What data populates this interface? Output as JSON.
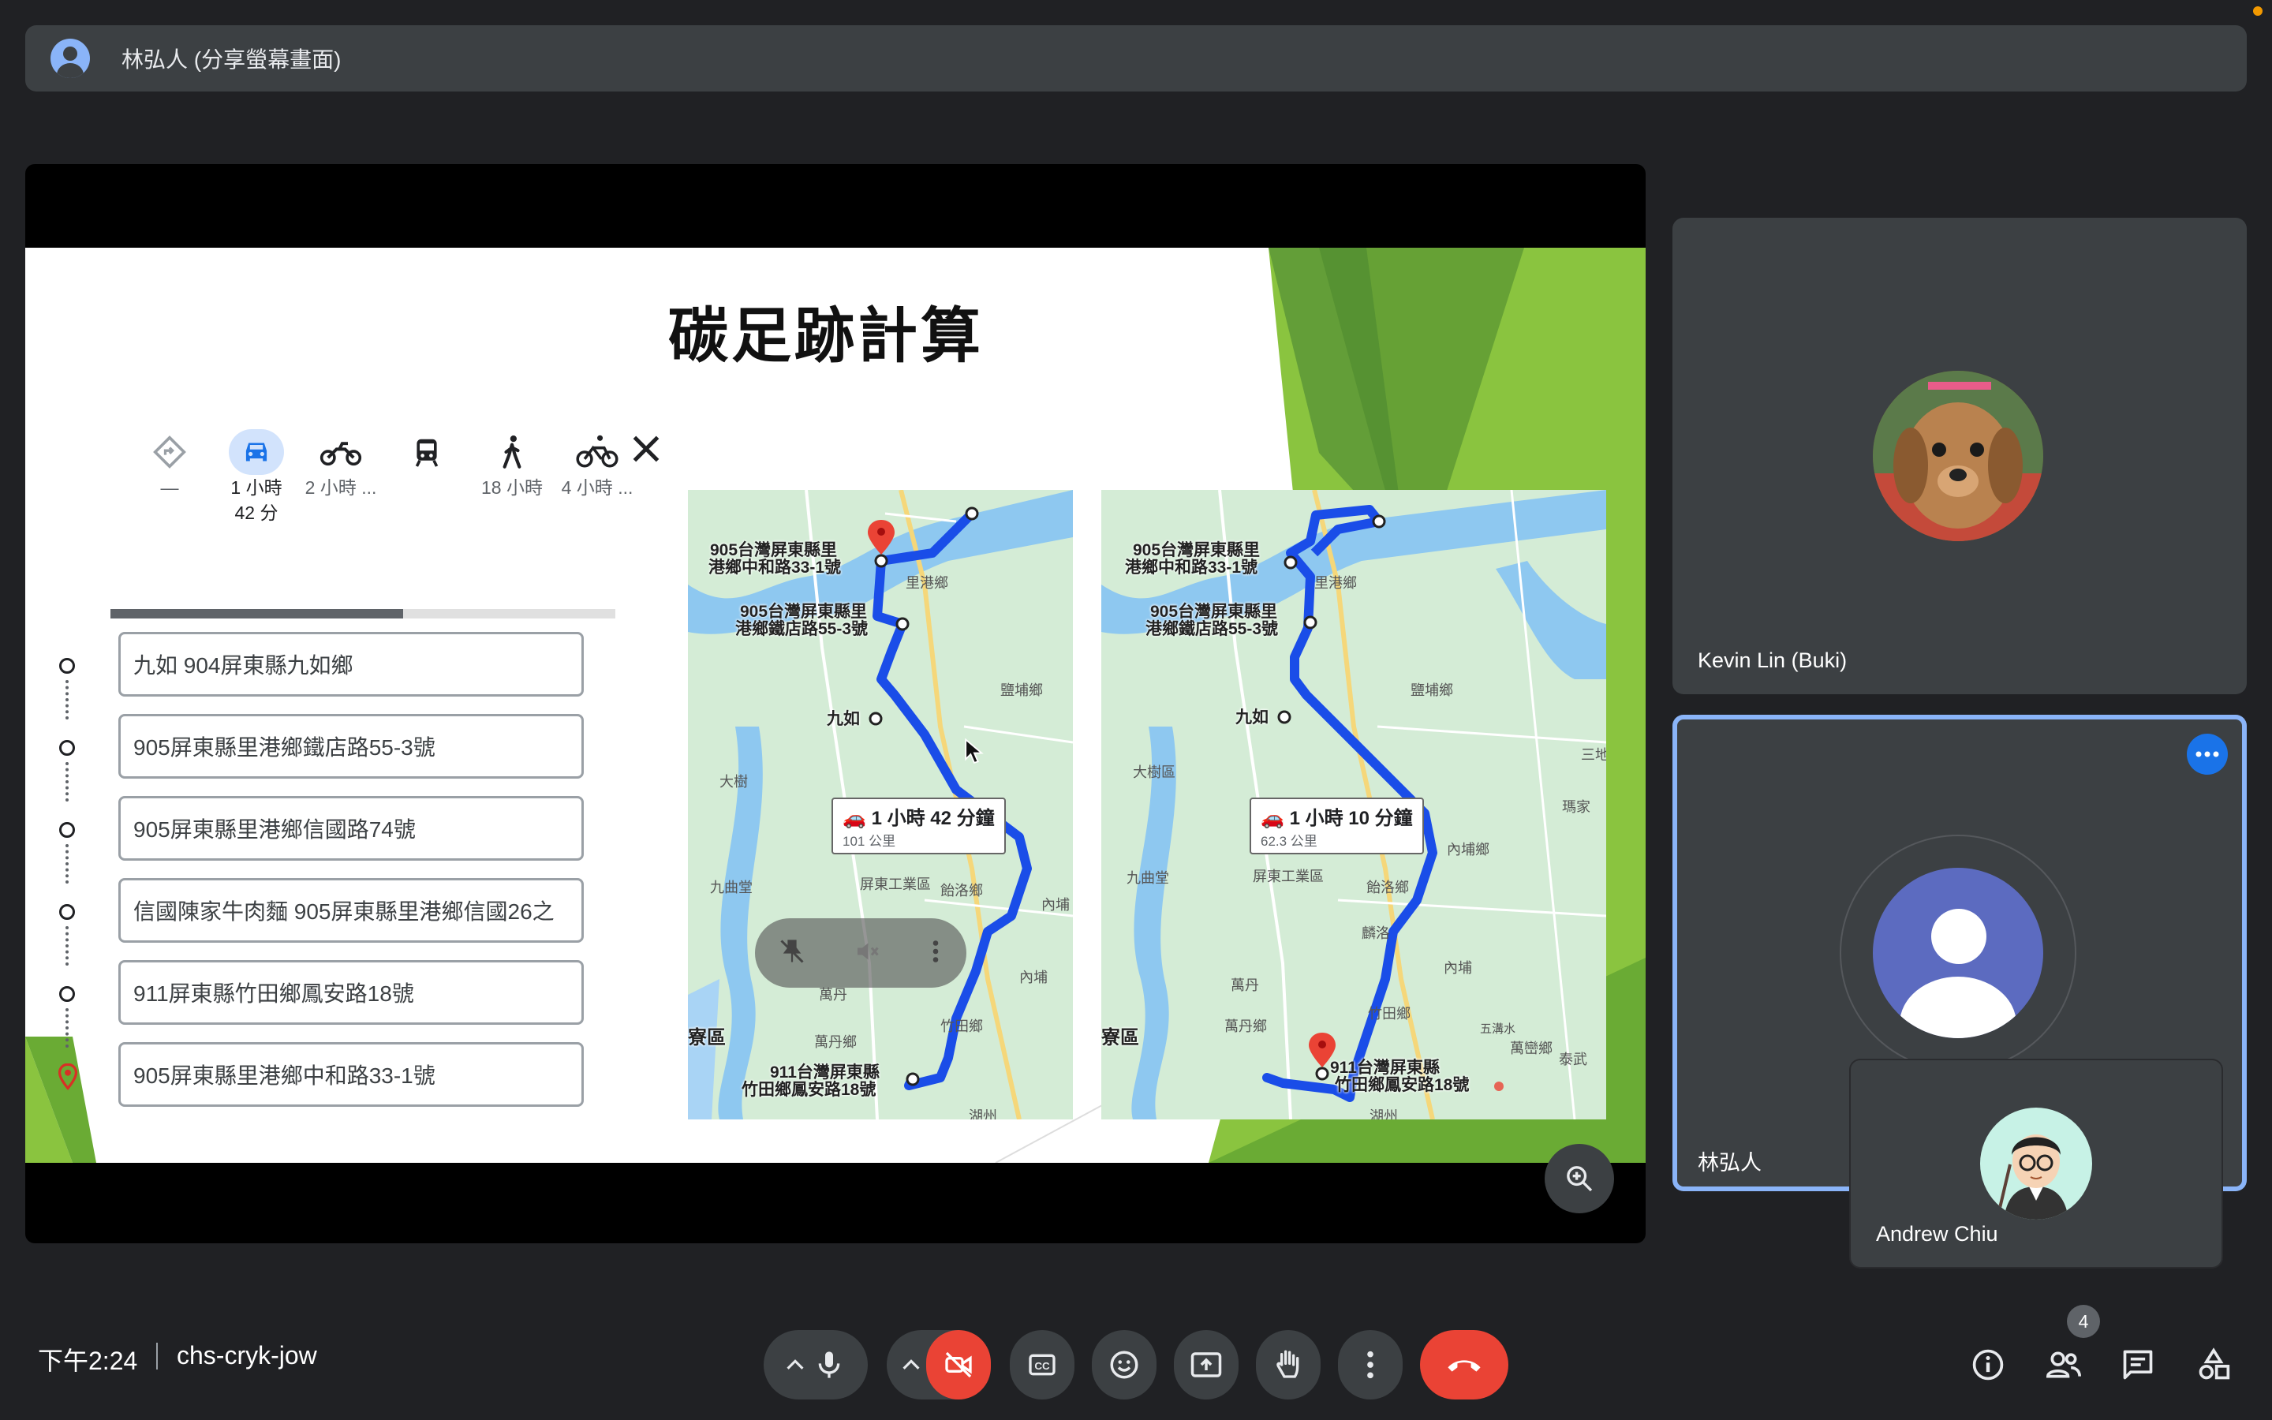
{
  "presenter_bar": {
    "title": "林弘人 (分享螢幕畫面)"
  },
  "slide": {
    "title": "碳足跡計算",
    "modes": [
      {
        "icon": "directions-icon",
        "label": "—"
      },
      {
        "icon": "car-icon",
        "label": "1 小時",
        "label2": "42 分",
        "selected": true
      },
      {
        "icon": "motorcycle-icon",
        "label": "2 小時 ..."
      },
      {
        "icon": "transit-icon",
        "label": ""
      },
      {
        "icon": "walk-icon",
        "label": "18 小時"
      },
      {
        "icon": "bike-icon",
        "label": "4 小時 ..."
      }
    ],
    "progress": 0.58,
    "stops": [
      "九如 904屏東縣九如鄉",
      "905屏東縣里港鄉鐵店路55-3號",
      "905屏東縣里港鄉信國路74號",
      "信國陳家牛肉麵 905屏東縣里港鄉信國26之",
      "911屏東縣竹田鄉鳳安路18號",
      "905屏東縣里港鄉中和路33-1號"
    ],
    "map1": {
      "labels": [
        "905台灣屏東縣里",
        "港鄉中和路33-1號",
        "905台灣屏東縣里",
        "港鄉鐵店路55-3號",
        "九如",
        "911台灣屏東縣",
        "竹田鄉鳳安路18號"
      ],
      "places": [
        "里港鄉",
        "鹽埔鄉",
        "大樹",
        "九曲堂",
        "屏東工業區",
        "飴洛鄉",
        "內埔",
        "萬丹",
        "萬丹鄉",
        "竹田鄉",
        "內埔",
        "寮區",
        "湖州"
      ],
      "callout_time": "1 小時 42 分鐘",
      "callout_dist": "101 公里"
    },
    "map2": {
      "labels": [
        "905台灣屏東縣里",
        "港鄉中和路33-1號",
        "905台灣屏東縣里",
        "港鄉鐵店路55-3號",
        "九如",
        "911台灣屏東縣",
        "竹田鄉鳳安路18號"
      ],
      "places": [
        "里港鄉",
        "鹽埔鄉",
        "大樹區",
        "九曲堂",
        "屏東工業區",
        "飴洛鄉",
        "內埔鄉",
        "瑪家",
        "萬丹",
        "萬丹鄉",
        "竹田鄉",
        "內埔",
        "寮區",
        "五溝水",
        "萬巒鄉",
        "泰武",
        "三地",
        "湖州",
        "麟洛"
      ],
      "callout_time": "1 小時 10 分鐘",
      "callout_dist": "62.3 公里"
    }
  },
  "participants": [
    {
      "name": "Kevin Lin (Buki)"
    },
    {
      "name": "林弘人"
    },
    {
      "name": "Andrew Chiu"
    }
  ],
  "bottom": {
    "time": "下午2:24",
    "meeting_code": "chs-cryk-jow",
    "people_count": "4"
  },
  "colors": {
    "background": "#202124",
    "tile": "#3c4043",
    "accent_blue": "#4285f4",
    "end_call": "#ea4335",
    "route": "#1a5cff"
  }
}
